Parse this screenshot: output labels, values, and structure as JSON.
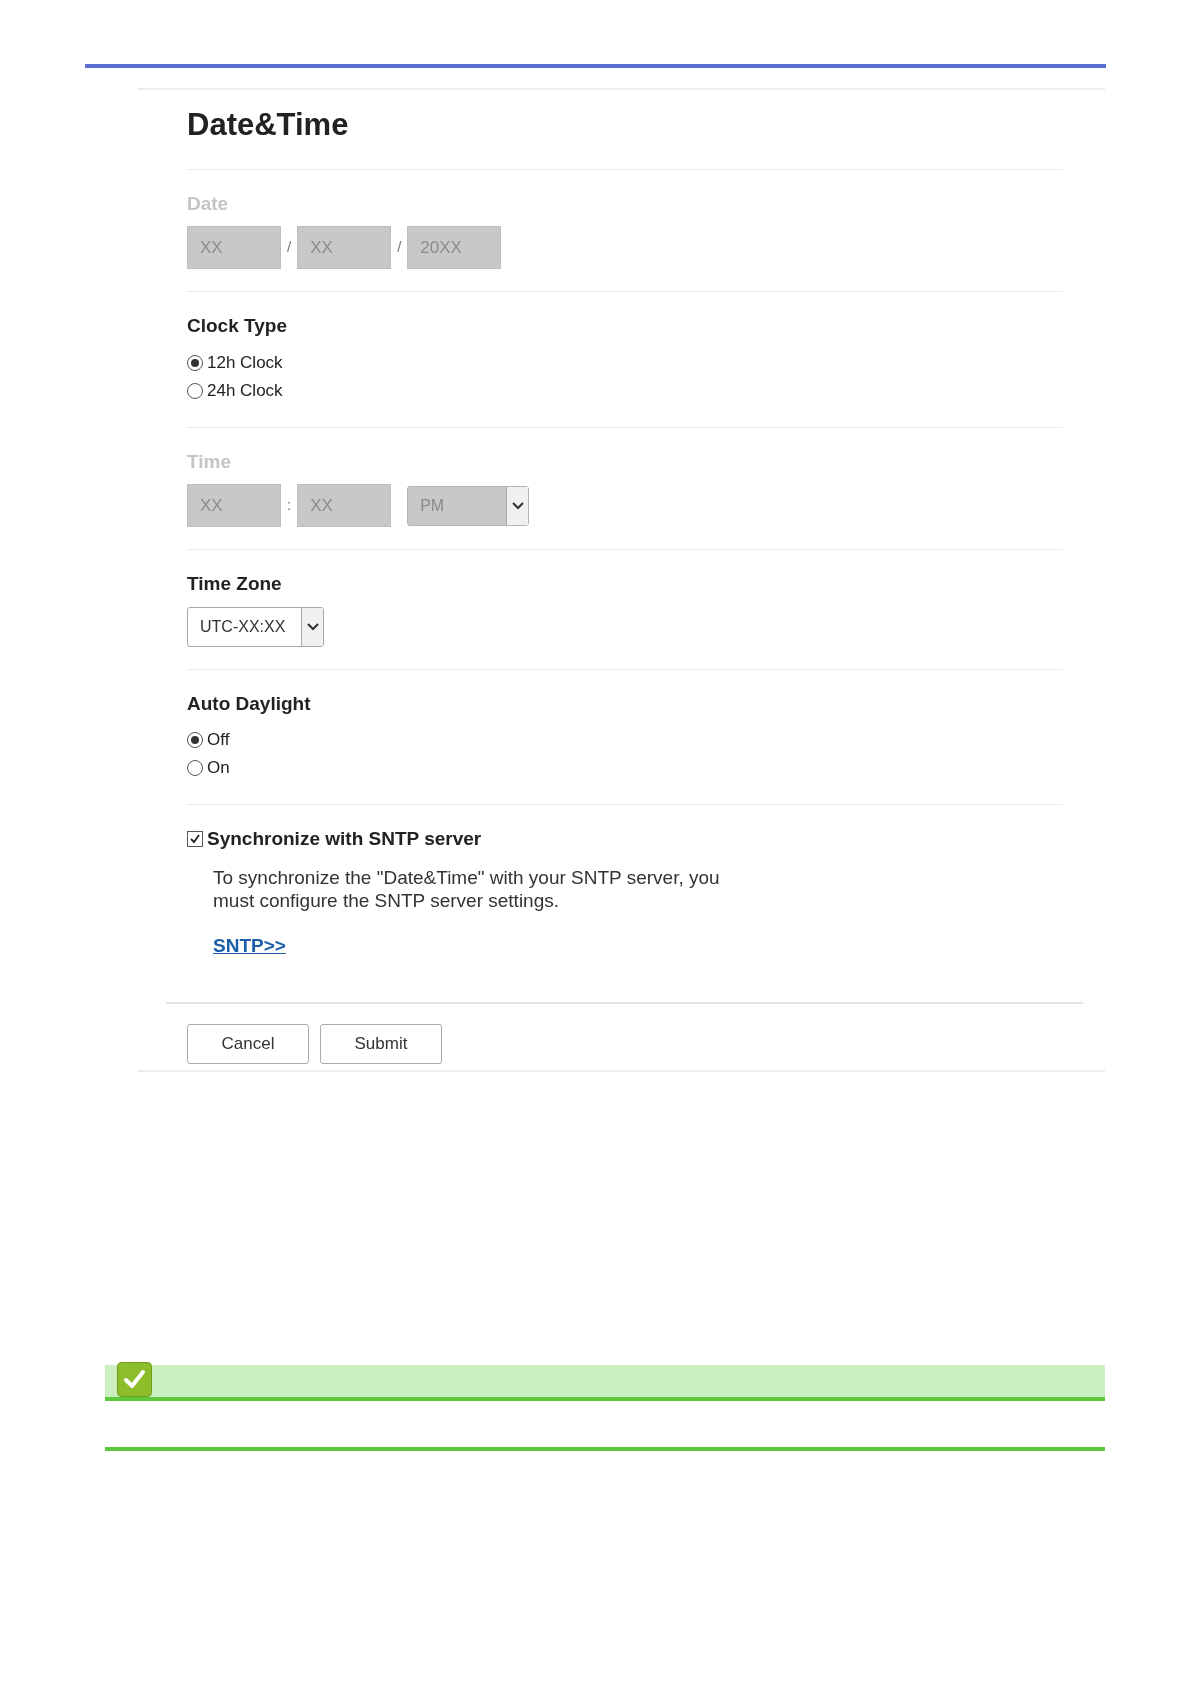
{
  "title": "Date&Time",
  "sections": [
    {
      "kind": "fields",
      "label": "Date",
      "disabled": true,
      "fields": [
        {
          "value": "XX"
        },
        {
          "separator": "/",
          "value": "XX"
        },
        {
          "separator": "/",
          "value": "20XX"
        }
      ]
    },
    {
      "kind": "radio",
      "label": "Clock Type",
      "options": [
        {
          "label": "12h Clock",
          "selected": true
        },
        {
          "label": "24h Clock",
          "selected": false
        }
      ]
    },
    {
      "kind": "fields",
      "label": "Time",
      "disabled": true,
      "fields": [
        {
          "value": "XX"
        },
        {
          "separator": ":",
          "value": "XX"
        }
      ],
      "select": {
        "value": "PM"
      }
    },
    {
      "kind": "select",
      "label": "Time Zone",
      "disabled": false,
      "select": {
        "value": "UTC-XX:XX"
      }
    },
    {
      "kind": "radio",
      "label": "Auto Daylight",
      "options": [
        {
          "label": "Off",
          "selected": true
        },
        {
          "label": "On",
          "selected": false
        }
      ]
    },
    {
      "kind": "checkbox",
      "label": "Synchronize with SNTP server",
      "checked": true,
      "description": "To synchronize the \"Date&Time\" with your SNTP server, you must configure the SNTP server settings.",
      "link": "SNTP>>"
    }
  ],
  "buttons": [
    "Cancel",
    "Submit"
  ]
}
